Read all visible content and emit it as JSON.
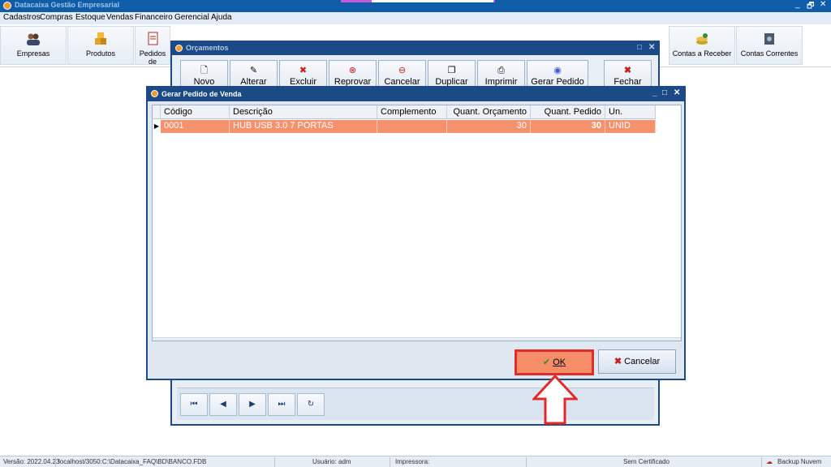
{
  "app": {
    "title": "Datacaixa Gestão Empresarial",
    "win_min": "_",
    "win_restore": "🗗",
    "win_close": "✕"
  },
  "menu": [
    "Cadastros",
    "Compras",
    "Estoque",
    "Vendas",
    "Financeiro",
    "Gerencial",
    "Ajuda"
  ],
  "toolbar": {
    "empresas": "Empresas",
    "produtos": "Produtos",
    "pedidos": "Pedidos de",
    "contas_receber": "Contas a Receber",
    "contas_correntes": "Contas Correntes"
  },
  "orcamentos": {
    "title": "Orçamentos",
    "buttons": {
      "novo": "Novo",
      "alterar": "Alterar",
      "excluir": "Excluir",
      "reprovar": "Reprovar",
      "cancelar": "Cancelar",
      "duplicar": "Duplicar",
      "imprimir": "Imprimir",
      "gerar_pedido": "Gerar Pedido",
      "fechar": "Fechar"
    },
    "nav": {
      "first": "⏮",
      "prev": "◀",
      "next": "▶",
      "last": "⏭",
      "refresh": "↻"
    }
  },
  "dialog": {
    "title": "Gerar Pedido de Venda",
    "columns": {
      "codigo": "Código",
      "descricao": "Descrição",
      "complemento": "Complemento",
      "quant_orcamento": "Quant. Orçamento",
      "quant_pedido": "Quant. Pedido",
      "un": "Un."
    },
    "rows": [
      {
        "codigo": "0001",
        "descricao": "HUB USB 3.0 7 PORTAS",
        "complemento": "",
        "quant_orcamento": "30",
        "quant_pedido": "30",
        "un": "UNID"
      }
    ],
    "ok_label": "OK",
    "cancel_label": "Cancelar"
  },
  "statusbar": {
    "versao": "Versão: 2022.04.23",
    "banco": "localhost/3050:C:\\Datacaixa_FAQ\\BD\\BANCO.FDB",
    "usuario": "Usuário: adm",
    "impressora": "Impressora:",
    "certificado": "Sem Certificado",
    "backup": "Backup Nuvem"
  },
  "colors": {
    "title_bar": "#0f5da8",
    "window_border": "#1b4a86",
    "selected_row": "#f4926e",
    "highlight": "#e12b2b"
  }
}
